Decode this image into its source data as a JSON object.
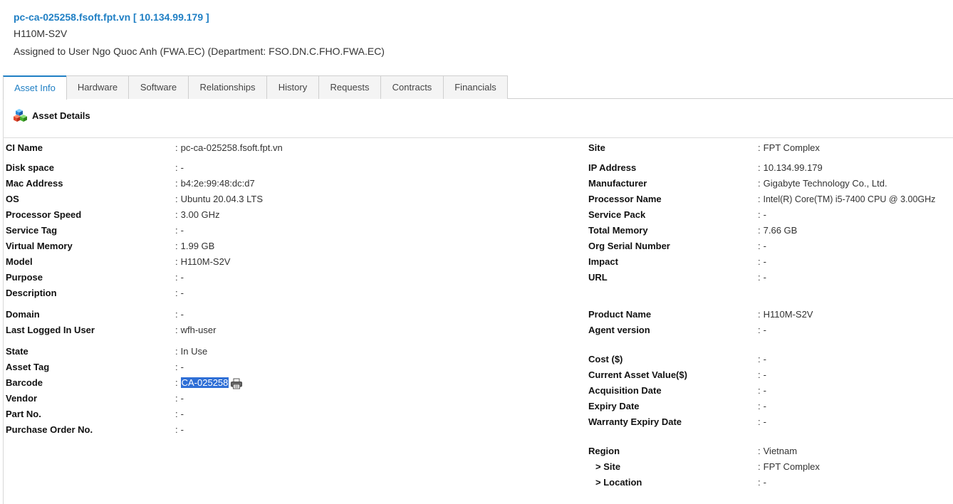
{
  "header": {
    "title": "pc-ca-025258.fsoft.fpt.vn [ 10.134.99.179 ]",
    "model": "H110M-S2V",
    "assigned": "Assigned to User Ngo Quoc Anh (FWA.EC) (Department: FSO.DN.C.FHO.FWA.EC)"
  },
  "tabs": [
    {
      "label": "Asset Info"
    },
    {
      "label": "Hardware"
    },
    {
      "label": "Software"
    },
    {
      "label": "Relationships"
    },
    {
      "label": "History"
    },
    {
      "label": "Requests"
    },
    {
      "label": "Contracts"
    },
    {
      "label": "Financials"
    }
  ],
  "section": {
    "title": "Asset Details",
    "icon": "cubes-icon"
  },
  "colon": ":",
  "left": [
    {
      "label": "CI Name",
      "value": "pc-ca-025258.fsoft.fpt.vn"
    },
    {
      "label": "Disk space",
      "value": "-"
    },
    {
      "label": "Mac Address",
      "value": "b4:2e:99:48:dc:d7"
    },
    {
      "label": "OS",
      "value": "Ubuntu 20.04.3 LTS"
    },
    {
      "label": "Processor Speed",
      "value": "3.00 GHz"
    },
    {
      "label": "Service Tag",
      "value": "-"
    },
    {
      "label": "Virtual Memory",
      "value": "1.99 GB"
    },
    {
      "label": "Model",
      "value": "H110M-S2V"
    },
    {
      "label": "Purpose",
      "value": "-"
    },
    {
      "label": "Description",
      "value": "-"
    },
    {
      "label": "Domain",
      "value": "-"
    },
    {
      "label": "Last Logged In User",
      "value": "wfh-user"
    },
    {
      "label": "State",
      "value": "In Use"
    },
    {
      "label": "Asset Tag",
      "value": "-"
    },
    {
      "label": "Barcode",
      "value": "CA-025258"
    },
    {
      "label": "Vendor",
      "value": "-"
    },
    {
      "label": "Part No.",
      "value": "-"
    },
    {
      "label": "Purchase Order No.",
      "value": "-"
    }
  ],
  "right": [
    {
      "label": "Site",
      "value": "FPT Complex"
    },
    {
      "label": "IP Address",
      "value": "10.134.99.179"
    },
    {
      "label": "Manufacturer",
      "value": "Gigabyte Technology Co., Ltd."
    },
    {
      "label": "Processor Name",
      "value": "Intel(R) Core(TM) i5-7400 CPU @ 3.00GHz"
    },
    {
      "label": "Service Pack",
      "value": "-"
    },
    {
      "label": "Total Memory",
      "value": "7.66 GB"
    },
    {
      "label": "Org Serial Number",
      "value": "-"
    },
    {
      "label": "Impact",
      "value": "-"
    },
    {
      "label": "URL",
      "value": "-"
    },
    {
      "label": "Product Name",
      "value": "H110M-S2V"
    },
    {
      "label": "Agent version",
      "value": "-"
    },
    {
      "label": "Cost ($)",
      "value": "-"
    },
    {
      "label": "Current Asset Value($)",
      "value": "-"
    },
    {
      "label": "Acquisition Date",
      "value": "-"
    },
    {
      "label": "Expiry Date",
      "value": "-"
    },
    {
      "label": "Warranty Expiry Date",
      "value": "-"
    },
    {
      "label": "Region",
      "value": "Vietnam"
    },
    {
      "label": "> Site",
      "value": "FPT Complex"
    },
    {
      "label": "> Location",
      "value": "-"
    }
  ],
  "colors": {
    "link": "#1f7fc4",
    "selection": "#2f6fd6"
  }
}
